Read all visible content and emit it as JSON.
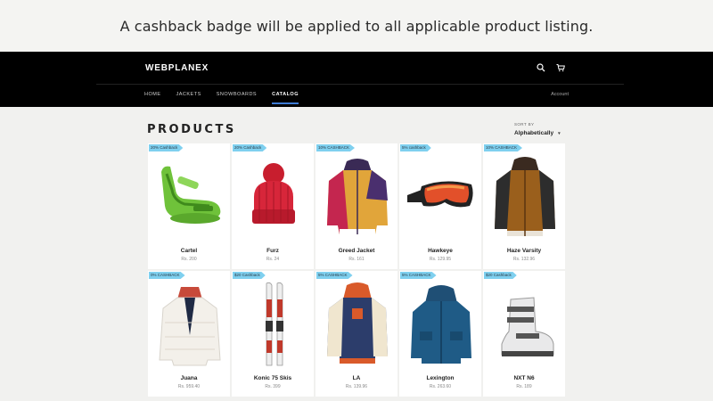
{
  "caption": "A cashback badge will be applied to all applicable product listing.",
  "header": {
    "brand": "WEBPLANEX",
    "icons": [
      "search-icon",
      "cart-icon"
    ],
    "nav": [
      "HOME",
      "JACKETS",
      "SNOWBOARDS",
      "CATALOG"
    ],
    "active_nav": "CATALOG",
    "account": "Account",
    "accent_color": "#3d7bd4"
  },
  "page": {
    "title": "PRODUCTS",
    "sort_label": "SORT BY",
    "sort_value": "Alphabetically"
  },
  "badge_color": "#7fd0ef",
  "products": [
    {
      "badge": "20% Cashback",
      "name": "Cartel",
      "price": "Rs. 200",
      "image": "snowboard-binding"
    },
    {
      "badge": "20% Cashback",
      "name": "Furz",
      "price": "Rs. 24",
      "image": "red-beanie"
    },
    {
      "badge": "10% CASHBACK",
      "name": "Greed Jacket",
      "price": "Rs. 161",
      "image": "color-jacket"
    },
    {
      "badge": "5% cashback",
      "name": "Hawkeye",
      "price": "Rs. 129.95",
      "image": "goggles"
    },
    {
      "badge": "10% CASHBACK",
      "name": "Haze Varsity",
      "price": "Rs. 132.96",
      "image": "brown-jacket"
    },
    {
      "badge": "0% CASHBACK",
      "name": "Juana",
      "price": "Rs. 959.40",
      "image": "white-jacket"
    },
    {
      "badge": "$20 Cashback",
      "name": "Konic 75 Skis",
      "price": "Rs. 399",
      "image": "skis"
    },
    {
      "badge": "5% CASHBACK",
      "name": "LA",
      "price": "Rs. 139.96",
      "image": "varsity-jacket"
    },
    {
      "badge": "5% CASHBACK",
      "name": "Lexington",
      "price": "Rs. 263.60",
      "image": "blue-parka"
    },
    {
      "badge": "$20 Cashback",
      "name": "NXT N6",
      "price": "Rs. 189",
      "image": "ski-boot"
    }
  ]
}
